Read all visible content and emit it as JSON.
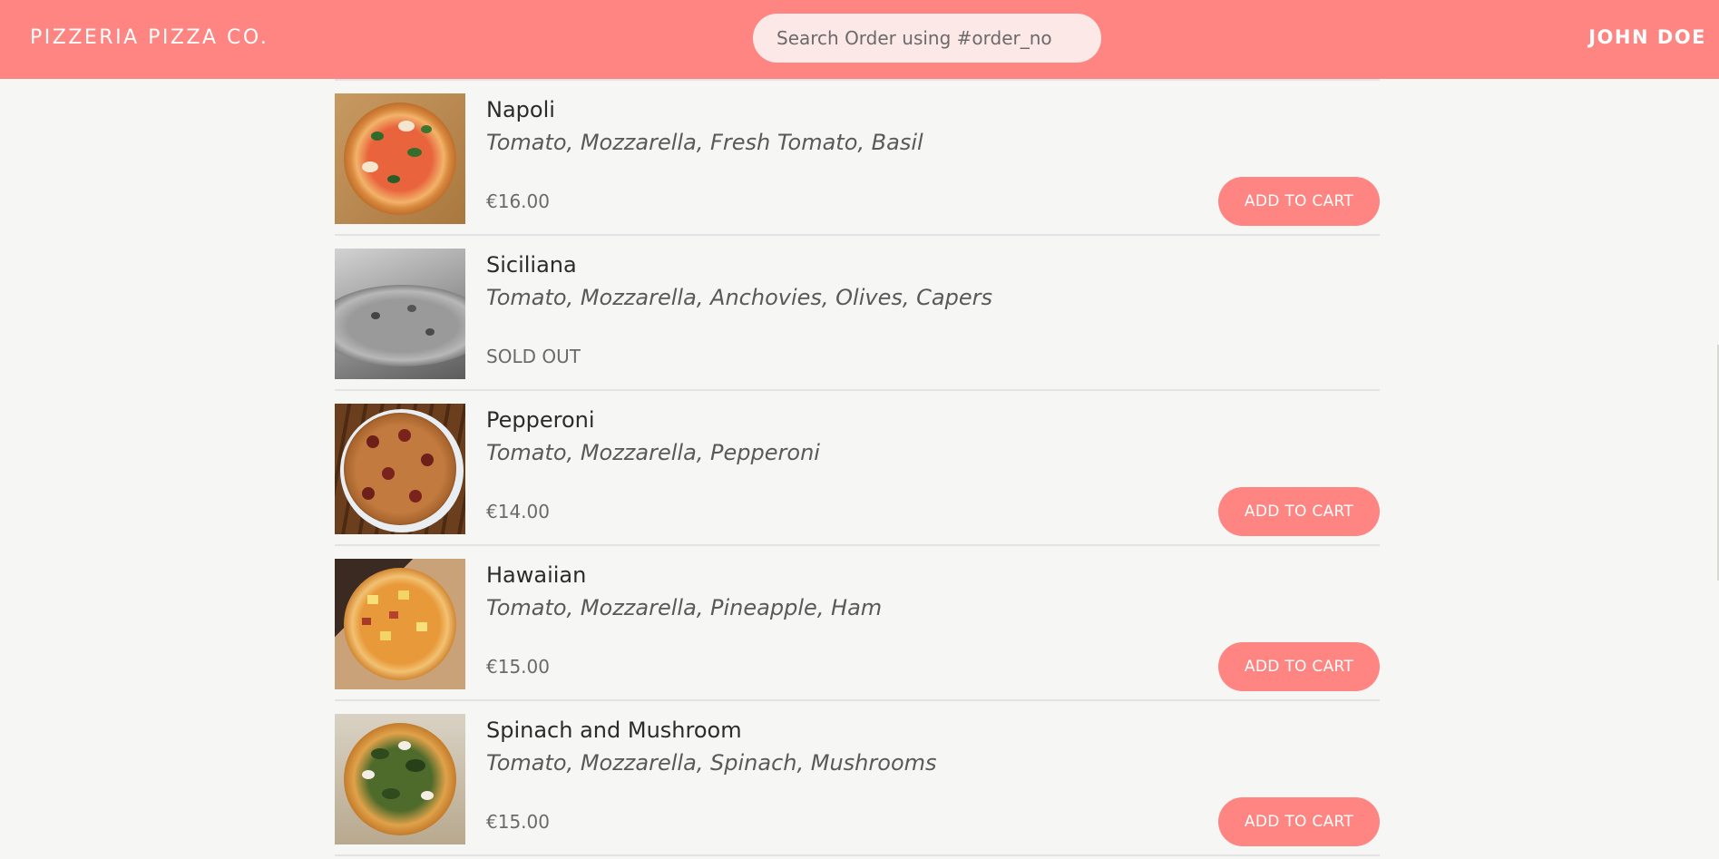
{
  "header": {
    "brand": "PIZZERIA PIZZA CO.",
    "search_placeholder": "Search Order using #order_no",
    "user_name": "JOHN DOE"
  },
  "menu": {
    "items": [
      {
        "name": "Napoli",
        "ingredients": "Tomato, Mozzarella, Fresh Tomato, Basil",
        "price": "€16.00",
        "button": "ADD TO CART"
      },
      {
        "name": "Siciliana",
        "ingredients": "Tomato, Mozzarella, Anchovies, Olives, Capers",
        "price": "SOLD OUT",
        "button": null
      },
      {
        "name": "Pepperoni",
        "ingredients": "Tomato, Mozzarella, Pepperoni",
        "price": "€14.00",
        "button": "ADD TO CART"
      },
      {
        "name": "Hawaiian",
        "ingredients": "Tomato, Mozzarella, Pineapple, Ham",
        "price": "€15.00",
        "button": "ADD TO CART"
      },
      {
        "name": "Spinach and Mushroom",
        "ingredients": "Tomato, Mozzarella, Spinach, Mushrooms",
        "price": "€15.00",
        "button": "ADD TO CART"
      }
    ]
  },
  "colors": {
    "accent": "#ff8583",
    "background": "#f6f6f4"
  }
}
